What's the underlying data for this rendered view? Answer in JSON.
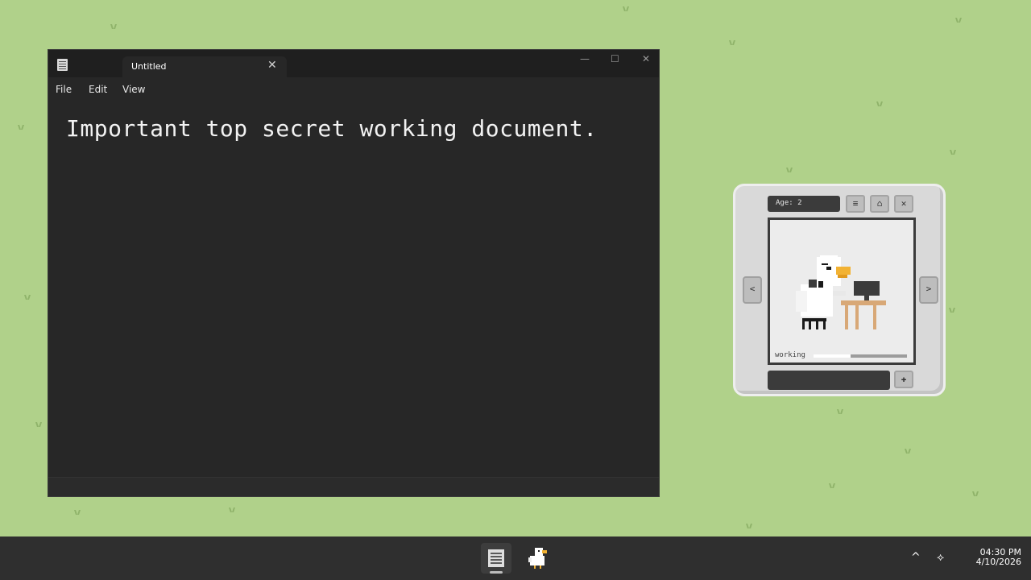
{
  "notepad": {
    "tab_title": "Untitled",
    "menu": [
      "File",
      "Edit",
      "View"
    ],
    "content": "Important top secret working document.",
    "icons": {
      "app": "notepad-icon",
      "tab_close": "close-icon"
    }
  },
  "pet_widget": {
    "age_label": "Age: 2",
    "status_label": "working",
    "status_progress": 0.4,
    "buttons": {
      "menu": "menu-icon",
      "home": "home-icon",
      "close": "close-icon",
      "prev": "chevron-left-icon",
      "next": "chevron-right-icon",
      "action": "gamepad-icon"
    }
  },
  "taskbar": {
    "apps": [
      "notepad-icon",
      "duck-pet-icon"
    ],
    "tray": [
      "chevron-up-icon",
      "network-icon"
    ],
    "time": "04:30 PM",
    "date": "4/10/2026"
  },
  "colors": {
    "desktop": "#b0d18a",
    "window_bg": "#272727",
    "taskbar_bg": "#2f2f2f",
    "duck_beak": "#f2b233",
    "desk": "#d8a877"
  }
}
